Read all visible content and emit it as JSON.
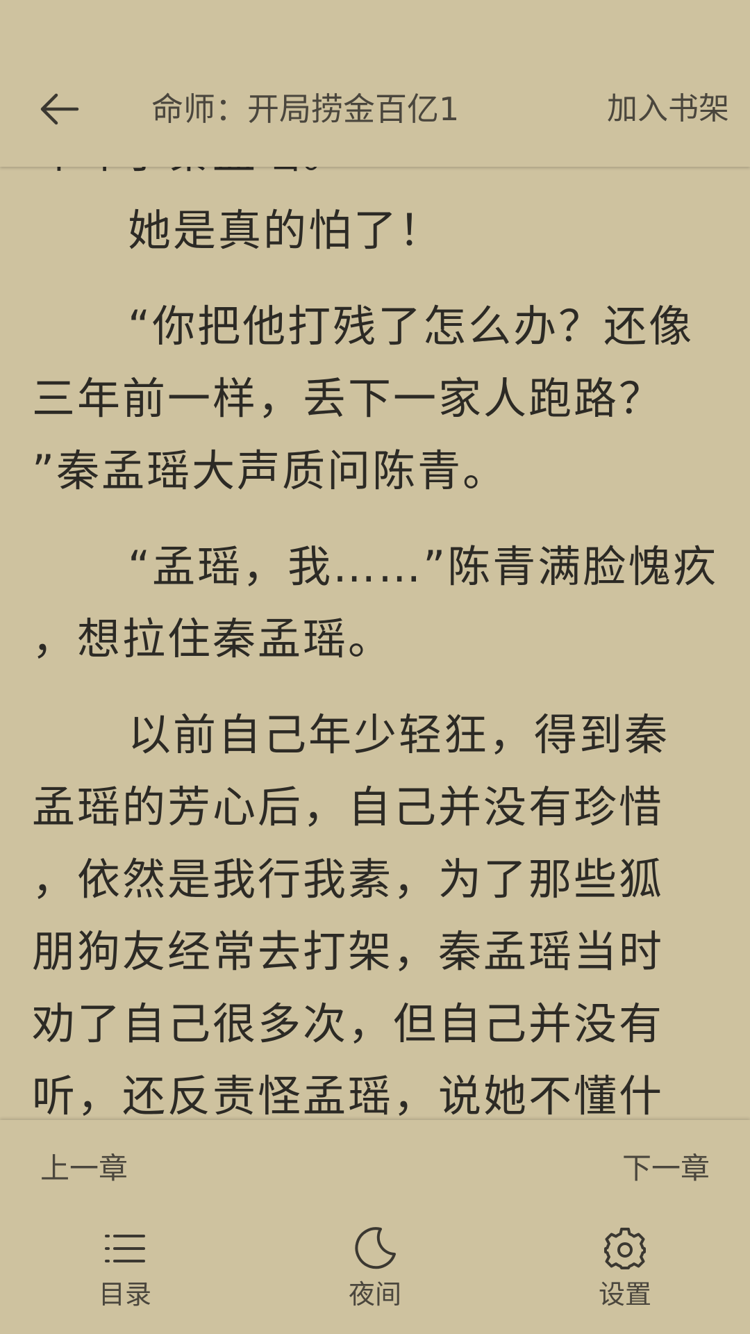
{
  "header": {
    "book_title": "命师：开局捞金百亿1",
    "add_shelf_label": "加入书架"
  },
  "reader": {
    "lines": [
      "吓坏了秦孟瑶。",
      "她是真的怕了！",
      "“你把他打残了怎么办？还像",
      "三年前一样，丢下一家人跑路？",
      "”秦孟瑶大声质问陈青。",
      "“孟瑶，我……”陈青满脸愧疚",
      "，想拉住秦孟瑶。",
      "以前自己年少轻狂，得到秦",
      "孟瑶的芳心后，自己并没有珍惜",
      "，依然是我行我素，为了那些狐",
      "朋狗友经常去打架，秦孟瑶当时",
      "劝了自己很多次，但自己并没有",
      "听，还反责怪孟瑶，说她不懂什"
    ]
  },
  "navigation": {
    "prev_chapter": "上一章",
    "next_chapter": "下一章"
  },
  "tabs": {
    "toc": {
      "label": "目录",
      "icon": "list-icon"
    },
    "night": {
      "label": "夜间",
      "icon": "moon-icon"
    },
    "settings": {
      "label": "设置",
      "icon": "gear-icon"
    }
  },
  "colors": {
    "background": "#cec29f",
    "text": "#2c2a25",
    "ui_text": "#4a463d"
  }
}
